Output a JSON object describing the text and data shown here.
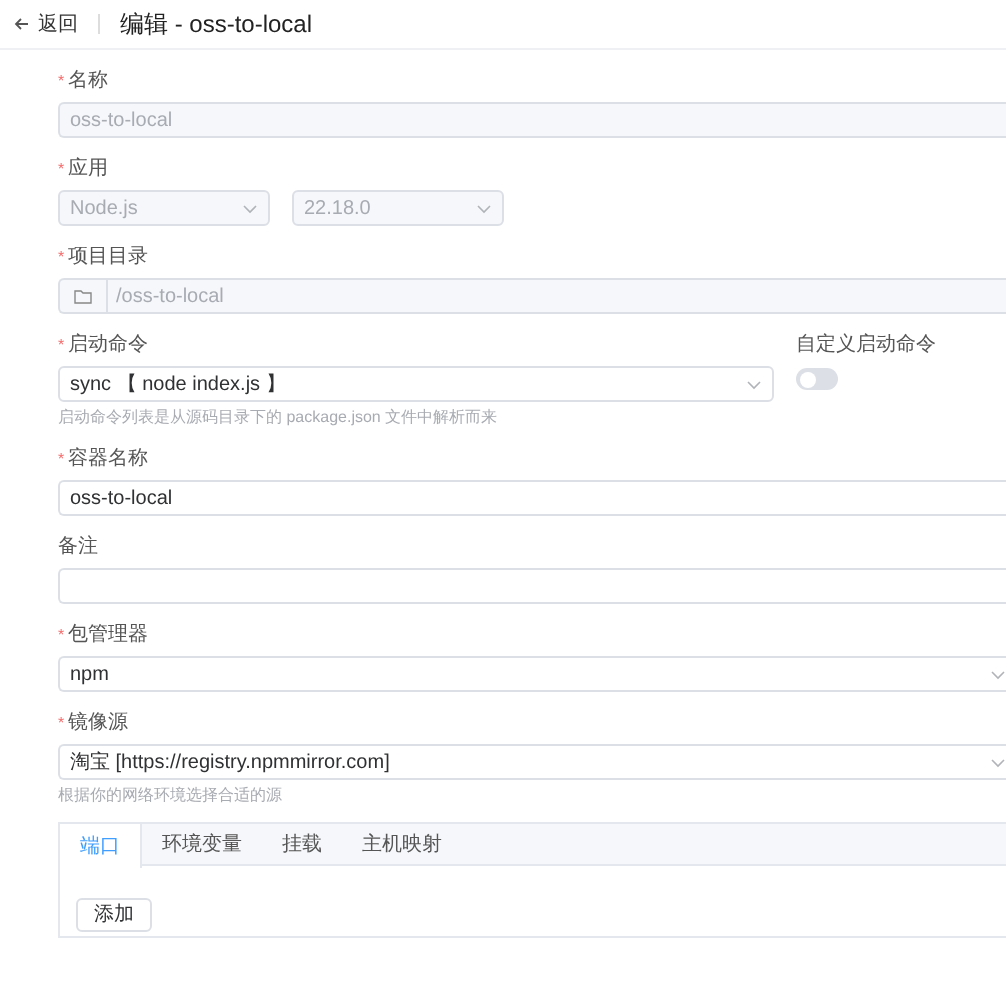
{
  "header": {
    "back": "返回",
    "title": "编辑 - oss-to-local"
  },
  "fields": [
    {
      "kind": "input",
      "label": "名称",
      "required": "*",
      "value": "oss-to-local",
      "disabled": true
    },
    {
      "kind": "selects",
      "label": "应用",
      "required": "*",
      "values": [
        "Node.js",
        "22.18.0"
      ],
      "disabled": true
    },
    {
      "kind": "path",
      "label": "项目目录",
      "required": "*",
      "value": "/oss-to-local",
      "disabled": true
    },
    {
      "kind": "command",
      "label": "启动命令",
      "required": "*",
      "value": "sync 【 node index.js 】",
      "switch_label": "自定义启动命令",
      "switch_on": false,
      "hint": "启动命令列表是从源码目录下的 package.json 文件中解析而来"
    },
    {
      "kind": "input",
      "label": "容器名称",
      "required": "*",
      "value": "oss-to-local",
      "disabled": false
    },
    {
      "kind": "input",
      "label": "备注"
    },
    {
      "kind": "select",
      "label": "包管理器",
      "required": "*",
      "value": "npm"
    },
    {
      "kind": "select",
      "label": "镜像源",
      "required": "*",
      "value": "淘宝 [https://registry.npmmirror.com]",
      "hint": "根据你的网络环境选择合适的源"
    }
  ],
  "tabs": [
    {
      "label": "端口",
      "selected": true
    },
    {
      "label": "环境变量",
      "selected": false
    },
    {
      "label": "挂载",
      "selected": false
    },
    {
      "label": "主机映射",
      "selected": false
    }
  ],
  "add_button": "添加"
}
